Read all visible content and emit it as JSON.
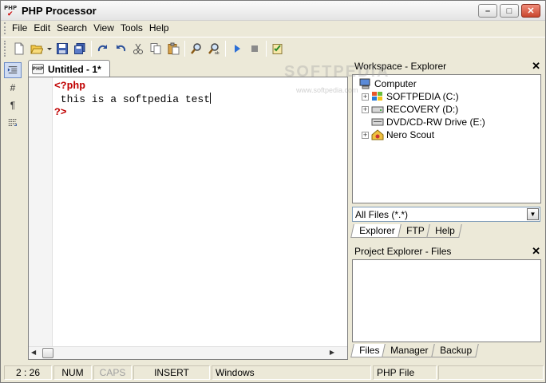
{
  "window": {
    "title": "PHP Processor",
    "app_icon_text": "PHP"
  },
  "menu": [
    "File",
    "Edit",
    "Search",
    "View",
    "Tools",
    "Help"
  ],
  "toolbar": {
    "buttons": [
      "new-file-icon",
      "open-file-icon",
      "open-dropdown-icon",
      "save-icon",
      "save-all-icon",
      "redo-icon",
      "undo-icon",
      "cut-icon",
      "copy-icon",
      "paste-icon",
      "find-icon",
      "find-replace-icon",
      "run-icon",
      "stop-icon",
      "checklist-icon"
    ]
  },
  "left_toolbar": {
    "hash_label": "#",
    "pilcrow_label": "¶"
  },
  "editor": {
    "tab_label": "Untitled - 1*",
    "tab_icon_text": "PHP",
    "lines": [
      "<?php",
      " this is a softpedia test",
      "?>"
    ]
  },
  "workspace": {
    "title": "Workspace - Explorer",
    "tree": [
      "Computer",
      "SOFTPEDIA (C:)",
      "RECOVERY (D:)",
      "DVD/CD-RW Drive (E:)",
      "Nero Scout"
    ],
    "filter_value": "All Files (*.*)",
    "tabs": [
      "Explorer",
      "FTP",
      "Help"
    ]
  },
  "project": {
    "title": "Project Explorer - Files",
    "tabs": [
      "Files",
      "Manager",
      "Backup"
    ]
  },
  "status": {
    "position": "2 : 26",
    "num": "NUM",
    "caps": "CAPS",
    "mode": "INSERT",
    "line_ending": "Windows",
    "file_type": "PHP File"
  },
  "watermark": {
    "text": "SOFTPEDIA",
    "url": "www.softpedia.com"
  },
  "colors": {
    "php_tag": "#c00000",
    "window_bg": "#ece9d8"
  }
}
